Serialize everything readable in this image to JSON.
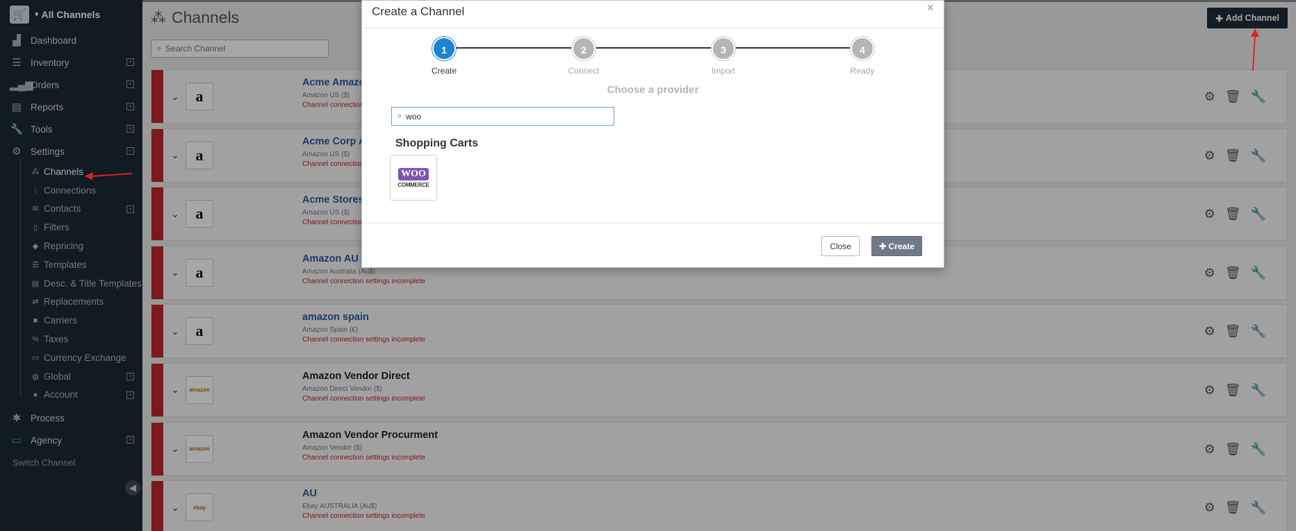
{
  "sidebar": {
    "top_title": "All Channels",
    "items": [
      {
        "label": "Dashboard",
        "icon": "bar-chart-icon"
      },
      {
        "label": "Inventory",
        "icon": "list-icon"
      },
      {
        "label": "Orders",
        "icon": "signal-icon"
      },
      {
        "label": "Reports",
        "icon": "report-icon"
      },
      {
        "label": "Tools",
        "icon": "wrench-icon"
      },
      {
        "label": "Settings",
        "icon": "gear-icon"
      }
    ],
    "sub_items": [
      {
        "label": "Channels",
        "icon": "channels-icon"
      },
      {
        "label": "Connections",
        "icon": "sitemap-icon"
      },
      {
        "label": "Contacts",
        "icon": "envelope-icon"
      },
      {
        "label": "Filters",
        "icon": "file-icon"
      },
      {
        "label": "Repricing",
        "icon": "tag-icon"
      },
      {
        "label": "Templates",
        "icon": "list-icon"
      },
      {
        "label": "Desc. & Title Templates",
        "icon": "list-alt-icon"
      },
      {
        "label": "Replacements",
        "icon": "exchange-icon"
      },
      {
        "label": "Carriers",
        "icon": "truck-icon"
      },
      {
        "label": "Taxes",
        "icon": "percent-icon"
      },
      {
        "label": "Currency Exchange",
        "icon": "money-icon"
      },
      {
        "label": "Global",
        "icon": "globe-icon"
      },
      {
        "label": "Account",
        "icon": "user-icon"
      }
    ],
    "process_label": "Process",
    "agency_label": "Agency",
    "switch_label": "Switch Channel"
  },
  "main": {
    "title": "Channels",
    "add_channel_label": "Add Channel",
    "search_placeholder": "Search Channel",
    "channels": [
      {
        "name": "Acme Amazon",
        "sub": "Amazon US ($)",
        "warn": "Channel connection settings incomplete",
        "logo": "a"
      },
      {
        "name": "Acme Corp A",
        "sub": "Amazon US ($)",
        "warn": "Channel connection settings incomplete",
        "logo": "a"
      },
      {
        "name": "Acme Stores",
        "sub": "Amazon US ($)",
        "warn": "Channel connection settings incomplete",
        "logo": "a"
      },
      {
        "name": "Amazon AU",
        "sub": "Amazon Australia (Au$)",
        "warn": "Channel connection settings incomplete",
        "logo": "a"
      },
      {
        "name": "amazon spain",
        "sub": "Amazon Spain (€)",
        "warn": "Channel connection settings incomplete",
        "logo": "a"
      },
      {
        "name": "Amazon Vendor Direct",
        "sub": "Amazon Direct Vendor ($)",
        "warn": "Channel connection settings incomplete",
        "logo": "amazon"
      },
      {
        "name": "Amazon Vendor Procurment",
        "sub": "Amazon Vendor ($)",
        "warn": "Channel connection settings incomplete",
        "logo": "amazon"
      },
      {
        "name": "AU",
        "sub": "Ebay AUSTRALIA (Au$)",
        "warn": "Channel connection settings incomplete",
        "logo": "ebay"
      }
    ]
  },
  "modal": {
    "title": "Create a Channel",
    "close_x": "×",
    "steps": [
      {
        "num": "1",
        "label": "Create"
      },
      {
        "num": "2",
        "label": "Connect"
      },
      {
        "num": "3",
        "label": "Import"
      },
      {
        "num": "4",
        "label": "Ready"
      }
    ],
    "provider_title": "Choose a provider",
    "search_value": "woo",
    "category": "Shopping Carts",
    "provider": {
      "badge": "WOO",
      "text": "COMMERCE"
    },
    "close_label": "Close",
    "create_label": "Create"
  },
  "colors": {
    "sidebar_bg": "#1b2a36",
    "accent_blue": "#1f84d0",
    "warning_red": "#c0262c",
    "woo_purple": "#7f54b3"
  }
}
